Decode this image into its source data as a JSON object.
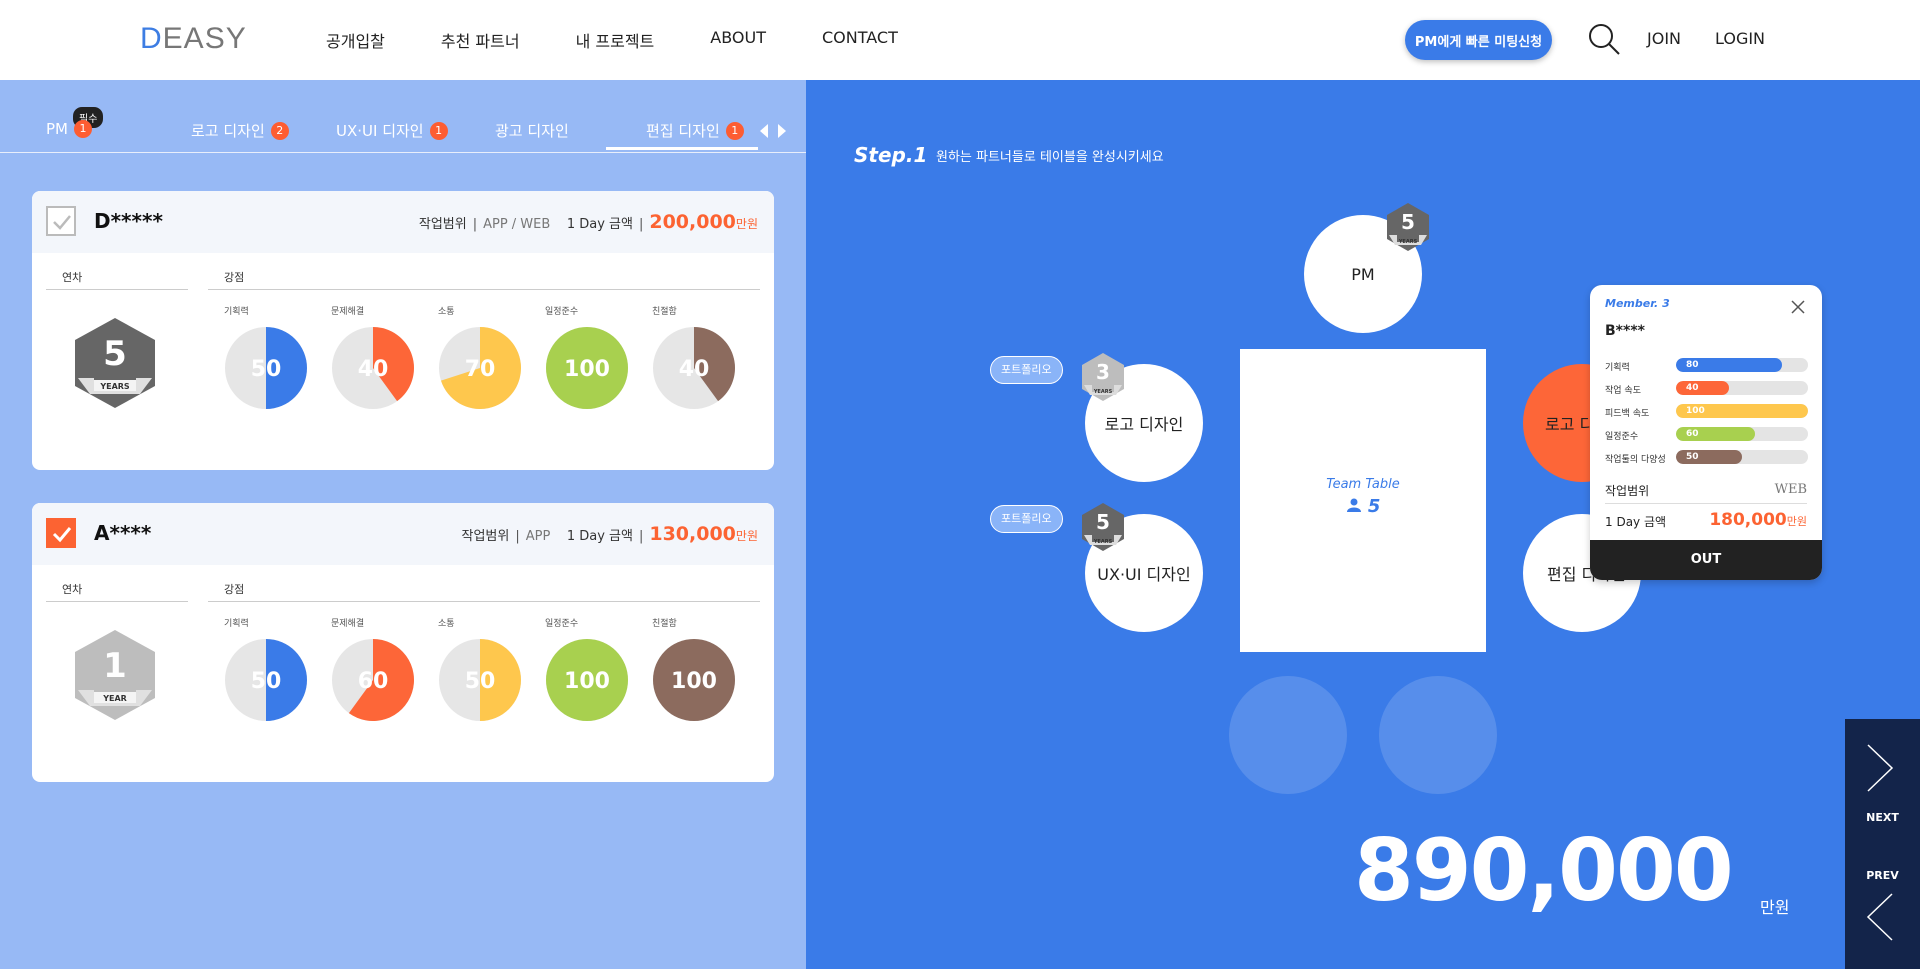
{
  "header": {
    "logo": "DEASY",
    "nav": [
      "공개입찰",
      "추천 파트너",
      "내 프로젝트",
      "ABOUT",
      "CONTACT"
    ],
    "pm_button": "PM에게 빠른 미팅신청",
    "join": "JOIN",
    "login": "LOGIN"
  },
  "tabs": {
    "required_badge": "필수",
    "items": [
      {
        "label": "PM",
        "count": "1"
      },
      {
        "label": "로고 디자인",
        "count": "2"
      },
      {
        "label": "UX·UI 디자인",
        "count": "1"
      },
      {
        "label": "광고 디자인",
        "count": ""
      },
      {
        "label": "편집 디자인",
        "count": "1"
      }
    ]
  },
  "cards": [
    {
      "name": "D*****",
      "scope_label": "작업범위",
      "scope": "APP / WEB",
      "day_label": "1 Day 금액",
      "price": "200,000",
      "unit": "만원",
      "checked": false,
      "years_label": "연차",
      "strengths_label": "강점",
      "years": "5",
      "years_text": "YEARS",
      "skills": [
        {
          "label": "기획력",
          "value": 50,
          "color": "#3a7be8"
        },
        {
          "label": "문제해결",
          "value": 40,
          "color": "#fd6638"
        },
        {
          "label": "소통",
          "value": 70,
          "color": "#fec74d"
        },
        {
          "label": "일정준수",
          "value": 100,
          "color": "#a8d04f"
        },
        {
          "label": "친절함",
          "value": 40,
          "color": "#8c6b5e"
        }
      ]
    },
    {
      "name": "A****",
      "scope_label": "작업범위",
      "scope": "APP",
      "day_label": "1 Day 금액",
      "price": "130,000",
      "unit": "만원",
      "checked": true,
      "years_label": "연차",
      "strengths_label": "강점",
      "years": "1",
      "years_text": "YEAR",
      "skills": [
        {
          "label": "기획력",
          "value": 50,
          "color": "#3a7be8"
        },
        {
          "label": "문제해결",
          "value": 60,
          "color": "#fd6638"
        },
        {
          "label": "소통",
          "value": 50,
          "color": "#fec74d"
        },
        {
          "label": "일정준수",
          "value": 100,
          "color": "#a8d04f"
        },
        {
          "label": "친절함",
          "value": 100,
          "color": "#8c6b5e"
        }
      ]
    }
  ],
  "right": {
    "step": "Step.1",
    "step_desc": "원하는 파트너들로 테이블을 완성시키세요",
    "team_table": "Team Table",
    "team_count": "5",
    "portfolio": "포트폴리오",
    "seats": {
      "pm": {
        "label": "PM",
        "years": "5"
      },
      "logo_left": {
        "label": "로고 디자인",
        "years": "3"
      },
      "uxui": {
        "label": "UX·UI 디자인",
        "years": "5"
      },
      "logo_right": {
        "label": "로고 디"
      },
      "edit": {
        "label": "편집 디자인"
      }
    },
    "hex_years_text": "YEARS",
    "total": "890,000",
    "total_unit": "만원",
    "member": {
      "tag": "Member. 3",
      "name": "B****",
      "stats": [
        {
          "label": "기획력",
          "value": 80,
          "color": "#3a7be8"
        },
        {
          "label": "작업 속도",
          "value": 40,
          "color": "#fd6638"
        },
        {
          "label": "피드백 속도",
          "value": 100,
          "color": "#fec74d"
        },
        {
          "label": "일정준수",
          "value": 60,
          "color": "#a8d04f"
        },
        {
          "label": "작업툴의 다양성",
          "value": 50,
          "color": "#8c6b5e"
        }
      ],
      "scope_label": "작업범위",
      "scope": "WEB",
      "day_label": "1 Day 금액",
      "price": "180,000",
      "unit": "만원",
      "out": "OUT"
    },
    "next": "NEXT",
    "prev": "PREV"
  }
}
